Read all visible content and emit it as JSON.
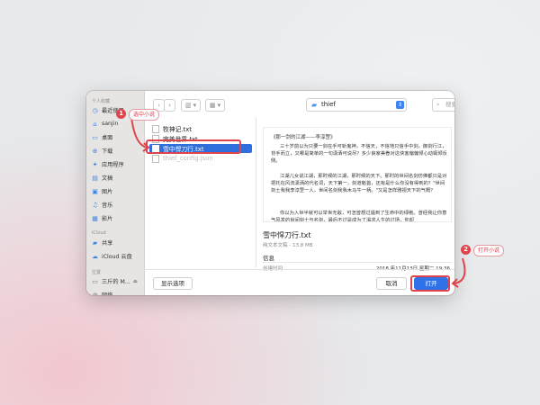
{
  "sidebar": {
    "sections": [
      {
        "label": "个人收藏"
      },
      {
        "label": "iCloud"
      },
      {
        "label": "位置"
      }
    ],
    "items": [
      {
        "label": "最近使用",
        "icon": "clock-icon"
      },
      {
        "label": "sanjin",
        "icon": "home-icon"
      },
      {
        "label": "桌面",
        "icon": "desktop-icon"
      },
      {
        "label": "下载",
        "icon": "download-icon"
      },
      {
        "label": "应用程序",
        "icon": "applications-icon"
      },
      {
        "label": "文稿",
        "icon": "document-icon"
      },
      {
        "label": "图片",
        "icon": "pictures-icon"
      },
      {
        "label": "音乐",
        "icon": "music-icon"
      },
      {
        "label": "影片",
        "icon": "movies-icon"
      },
      {
        "label": "共享",
        "icon": "shared-folder-icon"
      },
      {
        "label": "iCloud 云盘",
        "icon": "cloud-icon"
      },
      {
        "label": "三斤的 M...",
        "icon": "computer-icon"
      },
      {
        "label": "网络",
        "icon": "network-icon"
      }
    ]
  },
  "toolbar": {
    "back": "‹",
    "forward": "›",
    "path": "thief",
    "search_placeholder": "搜索"
  },
  "files": [
    {
      "name": "牧神记.txt"
    },
    {
      "name": "完美世界.txt"
    },
    {
      "name": "雪中悍刀行.txt"
    },
    {
      "name": "thief_config.json"
    }
  ],
  "preview": {
    "title": "《那一剑的江湖——李淳罡》",
    "paragraphs": [
      "三十岁前以为只要一剑在手可斩鬼神，不信天，不信地只信手中剑，御剑行江，背手而立，又哪是简单的一句潇洒可说尽？多少良家美眷对这侠客偏偏倾心动辄倾反侧。",
      "江湖儿女说江湖，那时候的江湖，那时候的天下。那时的世间名剑仿佛都只是对把托在风流潇洒的代名词，天下第一，剑道魁首，还有是什么你没有得到的？\"世间剑士我我李淳罡一人，世间名剑我我木马牛一柄。\"又是怎样雅视天下的气概？",
      "你以为入世半就可以举世无敌，可怎曾想过遇到了生命中的绿袍。曾经我让你意气风发的世间剑士与名剑，最后不过是成为了渴求人生的过场，你却"
    ]
  },
  "info": {
    "file_name": "雪中悍刀行.txt",
    "meta": "纯文本文稿 - 13.8 MB",
    "section": "信息",
    "created_label": "创建时间",
    "created_value": "2018 年11月13日 星期二 19:36"
  },
  "buttons": {
    "options": "显示选项",
    "cancel": "取消",
    "open": "打开"
  },
  "annotations": [
    {
      "number": "1",
      "text": "选中小说"
    },
    {
      "number": "2",
      "text": "打开小说"
    }
  ],
  "colors": {
    "accent": "#2f72e8",
    "annotation": "#e0434b"
  }
}
